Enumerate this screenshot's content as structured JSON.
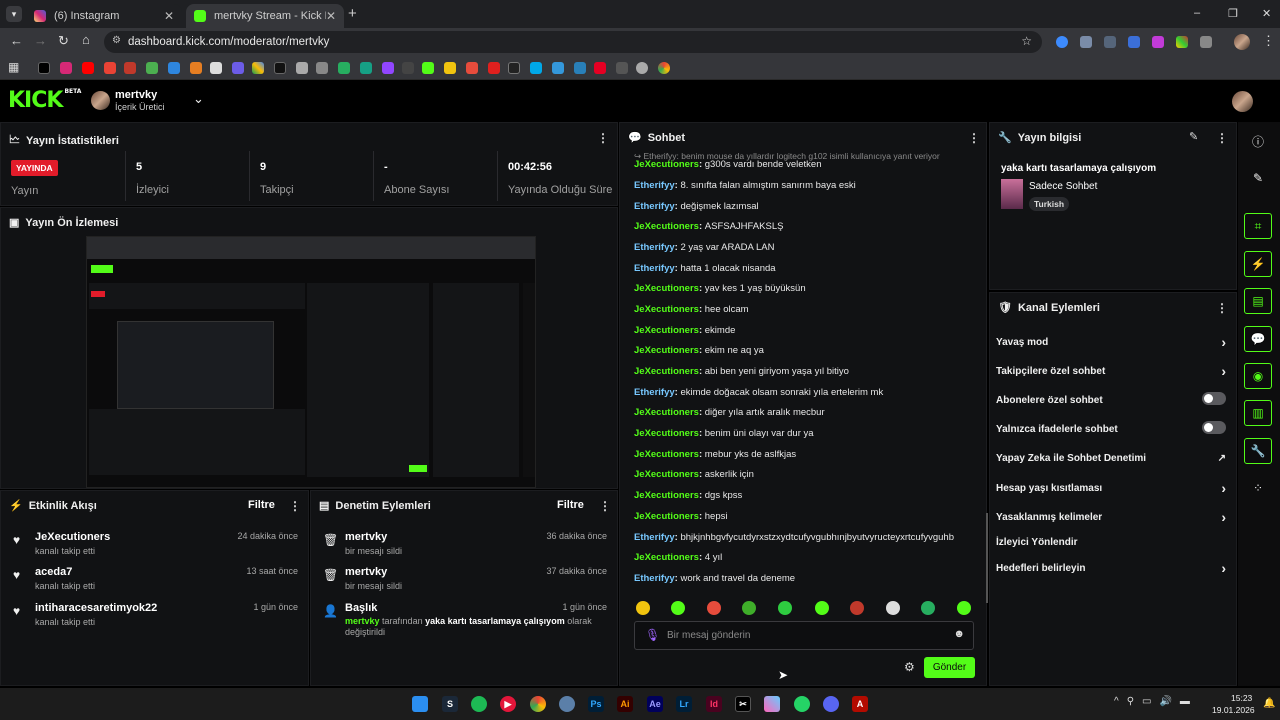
{
  "browser": {
    "tabs": [
      {
        "title": "(6) Instagram",
        "favicon_color": "#d62976"
      },
      {
        "title": "mertvky Stream - Kick Dashboa",
        "favicon_color": "#53fc18"
      }
    ],
    "url": "dashboard.kick.com/moderator/mertvky",
    "new_tab": "+",
    "window_controls": {
      "minimize": "–",
      "restore": "❐",
      "close": "✕"
    }
  },
  "header": {
    "logo": "KICK",
    "logo_badge": "BETA",
    "user_name": "mertvky",
    "user_role": "İçerik Üretici"
  },
  "stats": {
    "title": "Yayın İstatistikleri",
    "live_badge": "YAYINDA",
    "items": [
      {
        "value": "",
        "label": "Yayın"
      },
      {
        "value": "5",
        "label": "İzleyici"
      },
      {
        "value": "9",
        "label": "Takipçi"
      },
      {
        "value": "-",
        "label": "Abone Sayısı"
      },
      {
        "value": "00:42:56",
        "label": "Yayında Olduğu Süre"
      }
    ]
  },
  "preview": {
    "title": "Yayın Ön İzlemesi"
  },
  "activity": {
    "title": "Etkinlik Akışı",
    "filter": "Filtre",
    "items": [
      {
        "name": "JeXecutioners",
        "sub": "kanalı takip etti",
        "time": "24 dakika önce"
      },
      {
        "name": "aceda7",
        "sub": "kanalı takip etti",
        "time": "13 saat önce"
      },
      {
        "name": "intiharacesaretimyok22",
        "sub": "kanalı takip etti",
        "time": "1 gün önce"
      }
    ]
  },
  "moderation": {
    "title": "Denetim Eylemleri",
    "filter": "Filtre",
    "items": [
      {
        "name": "mertvky",
        "sub": "bir mesajı sildi",
        "time": "36 dakika önce"
      },
      {
        "name": "mertvky",
        "sub": "bir mesajı sildi",
        "time": "37 dakika önce"
      }
    ],
    "title_change": {
      "name": "Başlık",
      "time": "1 gün önce",
      "user": "mertvky",
      "mid": "tarafından",
      "new_title": "yaka kartı tasarlamaya çalışıyom",
      "end": "olarak",
      "end2": "değiştirildi"
    }
  },
  "chat": {
    "title": "Sohbet",
    "reply_hint": "Etherifyy: benim mouse da yıllardır logitech g102 isimli kullanıcıya yanıt veriyor",
    "messages": [
      {
        "user": "JeXecutioners",
        "color": "g",
        "text": "g300s vardı bende veletken"
      },
      {
        "user": "Etherifyy",
        "color": "b",
        "text": "8. sınıfta falan almıştım sanırım baya eski"
      },
      {
        "user": "Etherifyy",
        "color": "b",
        "text": "değişmek lazımsal"
      },
      {
        "user": "JeXecutioners",
        "color": "g",
        "text": "ASFSAJHFAKSLŞ"
      },
      {
        "user": "Etherifyy",
        "color": "b",
        "text": "2 yaş var ARADA LAN"
      },
      {
        "user": "Etherifyy",
        "color": "b",
        "text": "hatta 1 olacak nisanda"
      },
      {
        "user": "JeXecutioners",
        "color": "g",
        "text": "yav kes 1 yaş büyüksün"
      },
      {
        "user": "JeXecutioners",
        "color": "g",
        "text": "hee olcam"
      },
      {
        "user": "JeXecutioners",
        "color": "g",
        "text": "ekimde"
      },
      {
        "user": "JeXecutioners",
        "color": "g",
        "text": "ekim ne aq ya"
      },
      {
        "user": "JeXecutioners",
        "color": "g",
        "text": "abi ben yeni giriyom yaşa yıl bitiyo"
      },
      {
        "user": "Etherifyy",
        "color": "b",
        "text": "ekimde doğacak olsam sonraki yıla ertelerim mk"
      },
      {
        "user": "JeXecutioners",
        "color": "g",
        "text": "diğer yıla artık aralık mecbur"
      },
      {
        "user": "JeXecutioners",
        "color": "g",
        "text": "benim üni olayı var dur ya"
      },
      {
        "user": "JeXecutioners",
        "color": "g",
        "text": "mebur yks de aslfkjas"
      },
      {
        "user": "JeXecutioners",
        "color": "g",
        "text": "askerlik için"
      },
      {
        "user": "JeXecutioners",
        "color": "g",
        "text": "dgs kpss"
      },
      {
        "user": "JeXecutioners",
        "color": "g",
        "text": "hepsi"
      },
      {
        "user": "Etherifyy",
        "color": "b",
        "text": "bhjkjnhbgvfycutdyrxstzxydtcufyvgubhınjbyutvyructeyxrtcufyvguhb"
      },
      {
        "user": "JeXecutioners",
        "color": "g",
        "text": "4 yıl"
      },
      {
        "user": "Etherifyy",
        "color": "b",
        "text": "work and travel da deneme"
      }
    ],
    "input_placeholder": "Bir mesaj gönderin",
    "send": "Gönder"
  },
  "stream_info": {
    "title": "Yayın bilgisi",
    "stream_title": "yaka kartı tasarlamaya çalışıyom",
    "category": "Sadece Sohbet",
    "language": "Turkish"
  },
  "channel_actions": {
    "title": "Kanal Eylemleri",
    "items": [
      {
        "label": "Yavaş mod",
        "control": "chevron"
      },
      {
        "label": "Takipçilere özel sohbet",
        "control": "chevron"
      },
      {
        "label": "Abonelere özel sohbet",
        "control": "toggle"
      },
      {
        "label": "Yalnızca ifadelerle sohbet",
        "control": "toggle"
      },
      {
        "label": "Yapay Zeka ile Sohbet Denetimi",
        "control": "external"
      },
      {
        "label": "Hesap yaşı kısıtlaması",
        "control": "chevron"
      },
      {
        "label": "Yasaklanmış kelimeler",
        "control": "chevron"
      },
      {
        "label": "İzleyici Yönlendir",
        "control": "none"
      },
      {
        "label": "Hedefleri belirleyin",
        "control": "chevron"
      }
    ]
  },
  "taskbar": {
    "time": "15:23",
    "date": "19.01.2026"
  },
  "colors": {
    "accent": "#53fc18",
    "live": "#e21c2a",
    "panel": "#111214"
  }
}
